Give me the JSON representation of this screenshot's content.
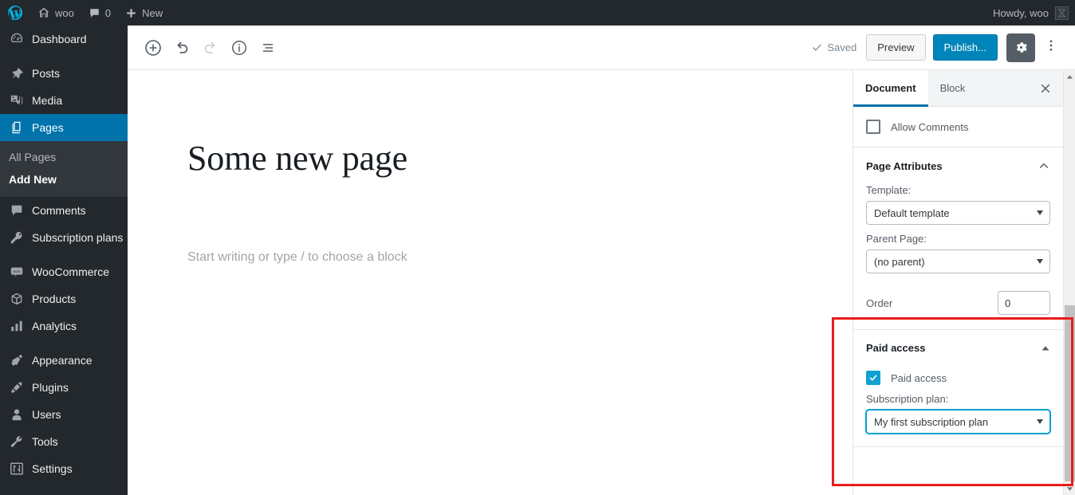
{
  "admin_bar": {
    "logo_icon": "wordpress-icon",
    "site_icon": "home-icon",
    "site_name": "woo",
    "comments_icon": "comment-bubble-icon",
    "comments_count": "0",
    "new_icon": "plus-icon",
    "new_label": "New",
    "howdy": "Howdy, woo",
    "avatar_icon": "broken-image-avatar-icon"
  },
  "sidebar": {
    "items": [
      {
        "label": "Dashboard",
        "icon": "dashboard-icon",
        "current": false,
        "sep_after": true
      },
      {
        "label": "Posts",
        "icon": "pin-icon",
        "current": false,
        "sep_after": false
      },
      {
        "label": "Media",
        "icon": "media-icon",
        "current": false,
        "sep_after": false
      },
      {
        "label": "Pages",
        "icon": "pages-icon",
        "current": true,
        "sep_after": false
      },
      {
        "label": "Comments",
        "icon": "comment-bubble-icon",
        "current": false,
        "sep_after": false
      },
      {
        "label": "Subscription plans",
        "icon": "key-icon",
        "current": false,
        "sep_after": true
      },
      {
        "label": "WooCommerce",
        "icon": "woo-icon",
        "current": false,
        "sep_after": false
      },
      {
        "label": "Products",
        "icon": "products-box-icon",
        "current": false,
        "sep_after": false
      },
      {
        "label": "Analytics",
        "icon": "bar-chart-icon",
        "current": false,
        "sep_after": true
      },
      {
        "label": "Appearance",
        "icon": "paint-brush-icon",
        "current": false,
        "sep_after": false
      },
      {
        "label": "Plugins",
        "icon": "plug-icon",
        "current": false,
        "sep_after": false
      },
      {
        "label": "Users",
        "icon": "user-icon",
        "current": false,
        "sep_after": false
      },
      {
        "label": "Tools",
        "icon": "wrench-icon",
        "current": false,
        "sep_after": false
      },
      {
        "label": "Settings",
        "icon": "sliders-icon",
        "current": false,
        "sep_after": false
      }
    ],
    "pages_submenu": [
      {
        "label": "All Pages",
        "current": false
      },
      {
        "label": "Add New",
        "current": true
      }
    ]
  },
  "toolbar": {
    "add_block_icon": "plus-circle-icon",
    "undo_icon": "undo-arrow-icon",
    "redo_icon": "redo-arrow-icon",
    "info_icon": "info-circle-icon",
    "block_navigation_icon": "block-list-icon",
    "saved_label": "Saved",
    "saved_icon": "checkmark-icon",
    "preview_label": "Preview",
    "publish_label": "Publish...",
    "settings_icon": "gear-icon",
    "more_icon": "ellipsis-vertical-icon"
  },
  "canvas": {
    "title": "Some new page",
    "placeholder": "Start writing or type / to choose a block"
  },
  "settings_sidebar": {
    "tabs": [
      {
        "label": "Document",
        "active": true
      },
      {
        "label": "Block",
        "active": false
      }
    ],
    "close_icon": "close-x-icon",
    "discussion": {
      "allow_comments_label": "Allow Comments",
      "allow_comments_checked": false
    },
    "page_attributes": {
      "title": "Page Attributes",
      "expanded": true,
      "chevron_icon": "chevron-up-icon",
      "template_label": "Template:",
      "template_value": "Default template",
      "parent_label": "Parent Page:",
      "parent_value": "(no parent)",
      "order_label": "Order",
      "order_value": "0"
    },
    "paid_access": {
      "title": "Paid access",
      "expanded": true,
      "chevron_icon": "chevron-up-icon",
      "checkbox_label": "Paid access",
      "checkbox_checked": true,
      "plan_label": "Subscription plan:",
      "plan_value": "My first subscription plan"
    },
    "scroll_up_icon": "scroll-arrow-up-icon",
    "scroll_down_icon": "scroll-arrow-down-icon"
  },
  "annotation": {
    "highlight_color": "#e81d1d"
  },
  "colors": {
    "admin_bar_bg": "#23282d",
    "sidebar_bg": "#23282d",
    "accent_blue": "#0073aa",
    "publish_blue": "#0085ba",
    "checkbox_blue": "#11a0d2",
    "focus_blue": "#00a0d2"
  }
}
